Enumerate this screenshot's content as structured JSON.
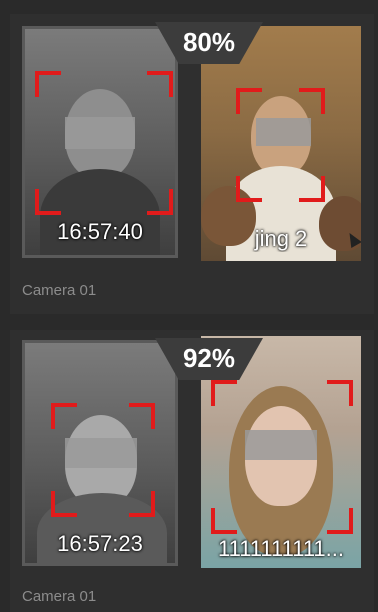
{
  "matches": [
    {
      "similarity": "80%",
      "capture_time": "16:57:40",
      "person_name": "jing 2",
      "camera": "Camera 01"
    },
    {
      "similarity": "92%",
      "capture_time": "16:57:23",
      "person_name": "1111111111...",
      "camera": "Camera 01"
    }
  ],
  "colors": {
    "background": "#2a2a2a",
    "panel": "#2f2f2f",
    "face_box": "#e11b1b",
    "label": "#8c8c8c"
  }
}
